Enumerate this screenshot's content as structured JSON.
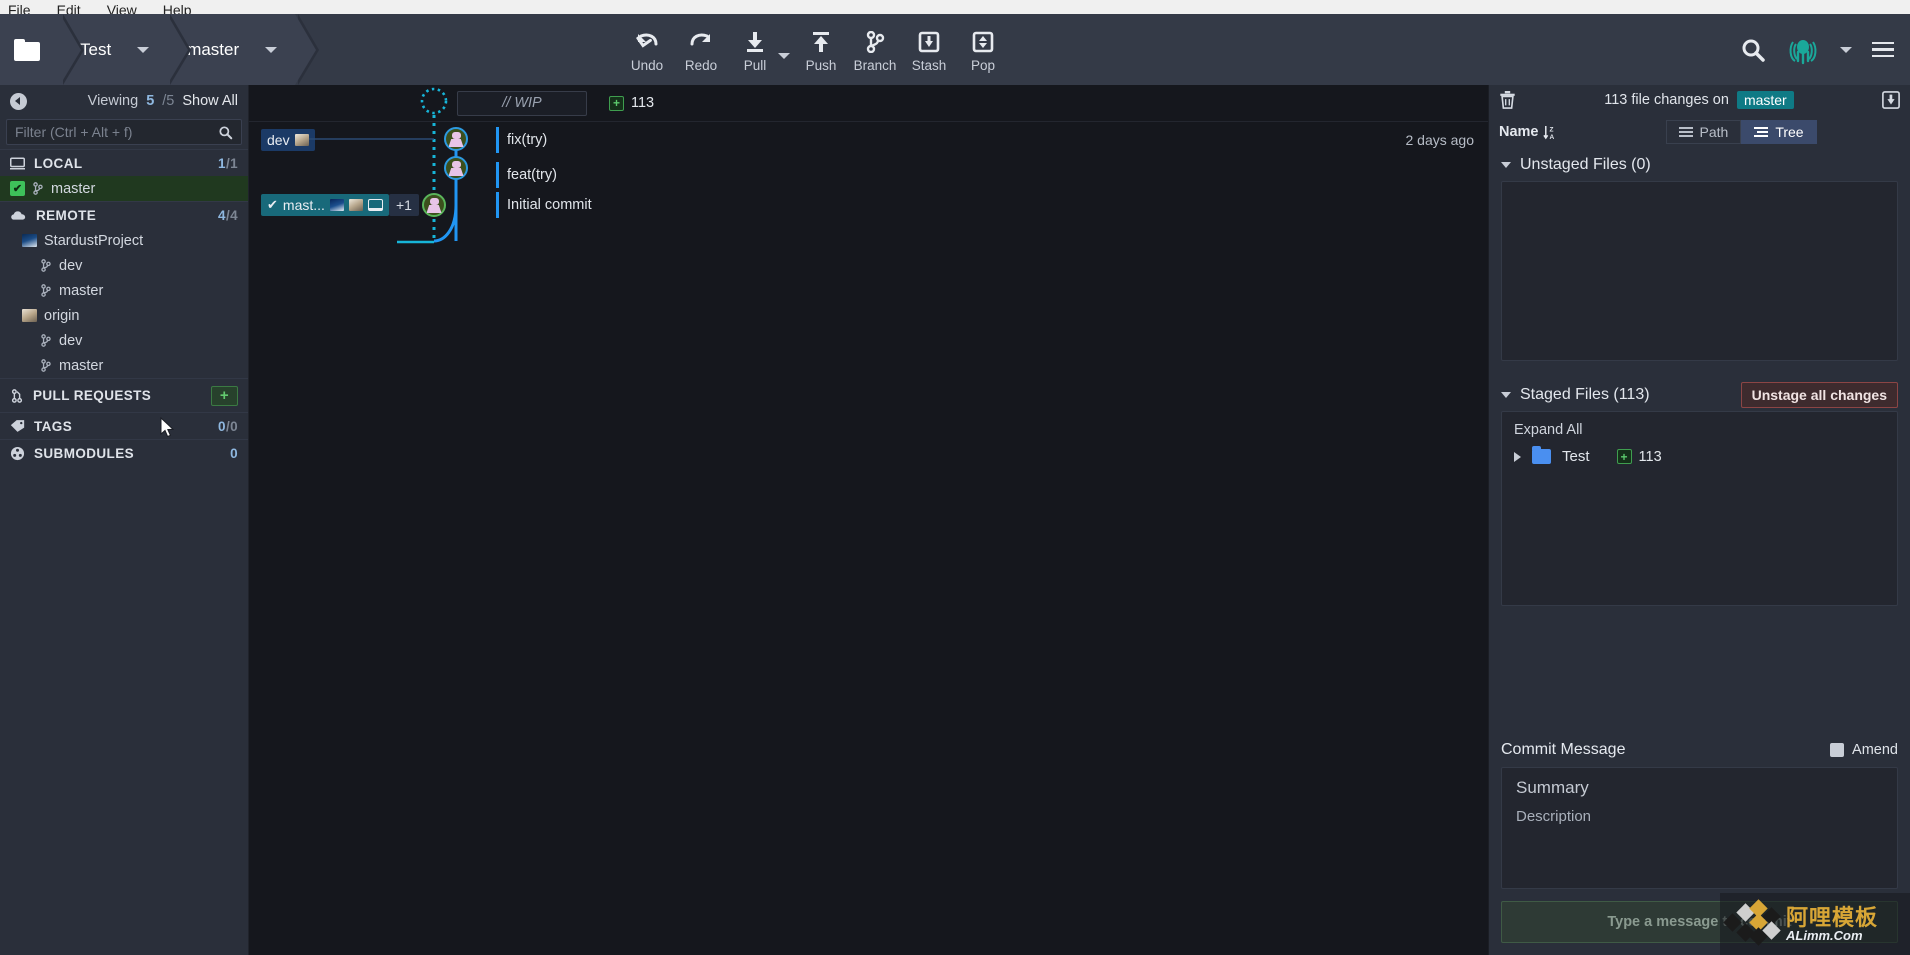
{
  "menubar": {
    "items": [
      "File",
      "Edit",
      "View",
      "Help"
    ]
  },
  "toolbar": {
    "repo_label": "Test",
    "branch_label": "master",
    "folder_icon": "folder-icon",
    "actions": [
      {
        "label": "Undo",
        "icon": "undo-icon"
      },
      {
        "label": "Redo",
        "icon": "redo-icon"
      },
      {
        "label": "Pull",
        "icon": "pull-icon"
      },
      {
        "label": "Push",
        "icon": "push-icon"
      },
      {
        "label": "Branch",
        "icon": "branch-icon"
      },
      {
        "label": "Stash",
        "icon": "stash-icon"
      },
      {
        "label": "Pop",
        "icon": "pop-icon"
      }
    ],
    "search_icon": "search-icon",
    "profile_icon": "gitkraken-logo-icon",
    "menu_icon": "hamburger-icon"
  },
  "sidebar": {
    "viewing_label": "Viewing",
    "viewing_num": "5",
    "viewing_den": "/5",
    "show_all": "Show All",
    "filter_placeholder": "Filter (Ctrl + Alt + f)",
    "sections": [
      {
        "title": "LOCAL",
        "count_a": "1",
        "count_b": "/1"
      },
      {
        "title": "REMOTE",
        "count_a": "4",
        "count_b": "/4"
      },
      {
        "title": "PULL REQUESTS",
        "add": "+"
      },
      {
        "title": "TAGS",
        "count_a": "0",
        "count_b": "/0"
      },
      {
        "title": "SUBMODULES",
        "count_a": "0",
        "count_b": ""
      }
    ],
    "local_branches": [
      {
        "name": "master"
      }
    ],
    "remotes": [
      {
        "name": "StardustProject",
        "branches": [
          "dev",
          "master"
        ]
      },
      {
        "name": "origin",
        "branches": [
          "dev",
          "master"
        ]
      }
    ]
  },
  "graph": {
    "wip_label": "// WIP",
    "wip_count": "113",
    "commits": [
      {
        "message": "fix(try)",
        "when": "2 days ago",
        "refs": [
          "dev"
        ]
      },
      {
        "message": "feat(try)",
        "when": "",
        "refs": []
      },
      {
        "message": "Initial commit",
        "when": "",
        "refs": [
          "master"
        ]
      }
    ],
    "dev_ref": "dev",
    "master_ref": "mast...",
    "extra_refs": "+1"
  },
  "right_panel": {
    "header_count": "113 file changes on",
    "header_branch": "master",
    "trash_icon": "trash-icon",
    "collapse_icon": "collapse-panel-icon",
    "sort_label": "Name",
    "view_path": "Path",
    "view_tree": "Tree",
    "unstaged_title": "Unstaged Files (0)",
    "staged_title": "Staged Files (113)",
    "unstage_all": "Unstage all changes",
    "expand_all": "Expand All",
    "staged_tree": [
      {
        "name": "Test",
        "count": "113"
      }
    ],
    "commit_message_label": "Commit Message",
    "amend_label": "Amend",
    "summary_placeholder": "Summary",
    "description_placeholder": "Description",
    "commit_button": "Type a message to commit"
  },
  "watermark": {
    "cn": "阿哩模板",
    "en": "ALimm.Com"
  },
  "colors": {
    "accent_blue": "#2196f3",
    "teal": "#0f7a85",
    "green": "#3ec15a",
    "toolbar_bg": "#343a47",
    "panel_bg": "#2a2f3a",
    "graph_bg": "#15171d"
  }
}
